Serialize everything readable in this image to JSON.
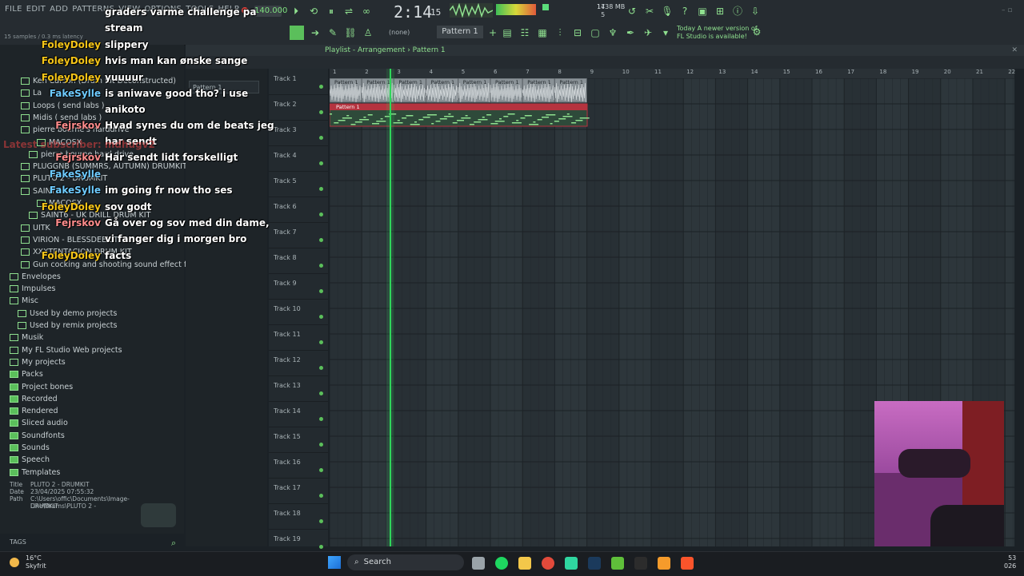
{
  "menu": [
    "FILE",
    "EDIT",
    "ADD",
    "PATTERNS",
    "VIEW",
    "OPTIONS",
    "TOOLS",
    "HELP"
  ],
  "toolbar": {
    "tempo": "140.000",
    "time_main": "2:14",
    "time_sub": "15",
    "memory": "1738 MB",
    "cpu_top": "14",
    "cpu_bottom": "5",
    "pattern_selector": "Pattern 1",
    "none_selector": "(none)",
    "news_line1": "Today  A newer version of",
    "news_line2": "FL Studio is available!",
    "latency": "15 samples / 0.3 ms latency"
  },
  "playlist": {
    "breadcrumb": "Playlist - Arrangement › Pattern 1",
    "pattern_item": "Pattern 1",
    "clip_label": "Pattern 1",
    "ruler": [
      "1",
      "2",
      "3",
      "4",
      "5",
      "6",
      "7",
      "8",
      "9",
      "10",
      "11",
      "12",
      "13",
      "14",
      "15",
      "16",
      "17",
      "18",
      "19",
      "20",
      "21",
      "22"
    ],
    "tracks": [
      "Track 1",
      "Track 2",
      "Track 3",
      "Track 4",
      "Track 5",
      "Track 6",
      "Track 7",
      "Track 8",
      "Track 9",
      "Track 10",
      "Track 11",
      "Track 12",
      "Track 13",
      "Track 14",
      "Track 15",
      "Track 16",
      "Track 17",
      "Track 18",
      "Track 19"
    ]
  },
  "browser": {
    "items": [
      "Ken Carson (Drum Kit Deconstructed)",
      "La",
      "Loops ( send labs )",
      "Midis ( send labs )",
      "pierre bourne's harddrive",
      "MACOSX",
      "pierre bourne hard drive",
      "PLUGGNB (SUMMRS, AUTUMN) DRUMKIT",
      "PLUTO 2 - DRUMKIT",
      "SAINT",
      "MACOSX",
      "SAINT6 - UK DRILL DRUM KIT",
      "UITK",
      "VIRION - BLESSDEEKIT",
      "XXXTENTACION DRUM KIT",
      "Gun cocking and shooting sound effect for video editing",
      "Envelopes",
      "Impulses",
      "Misc",
      "Used by demo projects",
      "Used by remix projects",
      "Musik",
      "My FL Studio Web projects",
      "My projects",
      "Packs",
      "Project bones",
      "Recorded",
      "Rendered",
      "Sliced audio",
      "Soundfonts",
      "Sounds",
      "Speech",
      "Templates"
    ],
    "info_title_label": "Title",
    "info_title": "PLUTO 2 - DRUMKIT",
    "info_date_label": "Date",
    "info_date": "23/04/2025 07:55:32",
    "info_path_label": "Path",
    "info_path1": "C:\\Users\\offic\\Documents\\Image-Line\\Drums\\PLUTO 2 -",
    "info_path2": "DRUMKIT",
    "tags": "TAGS"
  },
  "chat": [
    {
      "name": "",
      "msg": "graders varme challenge pa",
      "color": "yellow"
    },
    {
      "name": "",
      "msg": "stream",
      "color": "yellow"
    },
    {
      "name": "FoleyDoley",
      "msg": "slippery",
      "color": "yellow"
    },
    {
      "name": "FoleyDoley",
      "msg": "hvis man kan ønske sange",
      "color": "yellow"
    },
    {
      "name": "FoleyDoley",
      "msg": "yuuuur",
      "color": "yellow"
    },
    {
      "name": "FakeSylle",
      "msg": "is aniwave good tho? i use",
      "color": "blue"
    },
    {
      "name": "",
      "msg": "anikoto",
      "color": "blue"
    },
    {
      "name": "Fejrskov",
      "msg": "Hvad synes du om de beats jeg",
      "color": "red"
    },
    {
      "name": "",
      "msg": "har sendt",
      "color": "red"
    },
    {
      "name": "Fejrskov",
      "msg": "Har sendt lidt forskelligt",
      "color": "red"
    },
    {
      "name": "FakeSylle",
      "msg": "",
      "color": "blue"
    },
    {
      "name": "FakeSylle",
      "msg": "im going fr now tho ses",
      "color": "blue"
    },
    {
      "name": "FoleyDoley",
      "msg": "sov godt",
      "color": "yellow"
    },
    {
      "name": "Fejrskov",
      "msg": "Gå over og sov med din dame,",
      "color": "red"
    },
    {
      "name": "",
      "msg": "vi fanger dig i morgen bro",
      "color": "red"
    },
    {
      "name": "FoleyDoley",
      "msg": "facts",
      "color": "yellow"
    }
  ],
  "overlay_text": {
    "latest_subscriber": "Latest subscriber: mdhugv2"
  },
  "taskbar": {
    "temp": "16°C",
    "weather": "Skyfrit",
    "search": "Search",
    "clock1": "53",
    "clock2": "026"
  },
  "colors": {
    "accent": "#8fe08f",
    "playhead": "#2fd65a",
    "clip_red": "#b5333f"
  }
}
